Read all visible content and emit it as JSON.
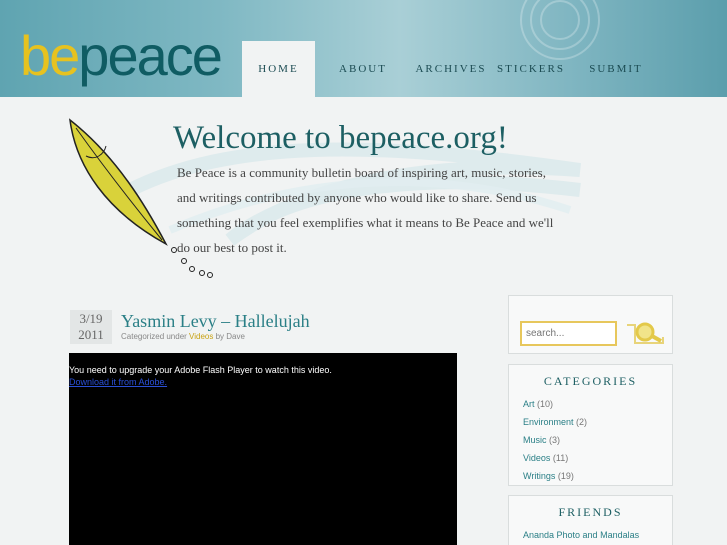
{
  "header": {
    "logo_be": "be",
    "logo_peace": "peace",
    "nav": [
      {
        "label": "HOME",
        "active": true
      },
      {
        "label": "ABOUT",
        "active": false
      },
      {
        "label": "ARCHIVES",
        "active": false
      },
      {
        "label": "STICKERS",
        "active": false
      },
      {
        "label": "SUBMIT",
        "active": false
      }
    ]
  },
  "welcome": {
    "title": "Welcome to bepeace.org!",
    "text": "Be Peace is a community bulletin board of inspiring art, music, stories, and writings contributed by anyone who would like to share. Send us something that you feel exemplifies what it means to Be Peace and we'll do our best to post it."
  },
  "post": {
    "date_month_day": "3/19",
    "date_year": "2011",
    "title": "Yasmin Levy – Hallelujah",
    "meta_prefix": "Categorized under ",
    "meta_category": "Videos",
    "meta_by": " by ",
    "meta_author": "Dave",
    "video_message": "You need to upgrade your Adobe Flash Player to watch this video.",
    "video_link": "Download it from Adobe."
  },
  "sidebar": {
    "search_placeholder": "search...",
    "categories_title": "CATEGORIES",
    "categories": [
      {
        "name": "Art",
        "count": "(10)"
      },
      {
        "name": "Environment",
        "count": "(2)"
      },
      {
        "name": "Music",
        "count": "(3)"
      },
      {
        "name": "Videos",
        "count": "(11)"
      },
      {
        "name": "Writings",
        "count": "(19)"
      }
    ],
    "friends_title": "FRIENDS",
    "friends": [
      {
        "name": "Ananda Photo and Mandalas"
      }
    ]
  },
  "colors": {
    "header_teal": "#7fb8c3",
    "logo_yellow": "#e7c21f",
    "logo_teal": "#0f5c63",
    "link_teal": "#2a7f86"
  }
}
